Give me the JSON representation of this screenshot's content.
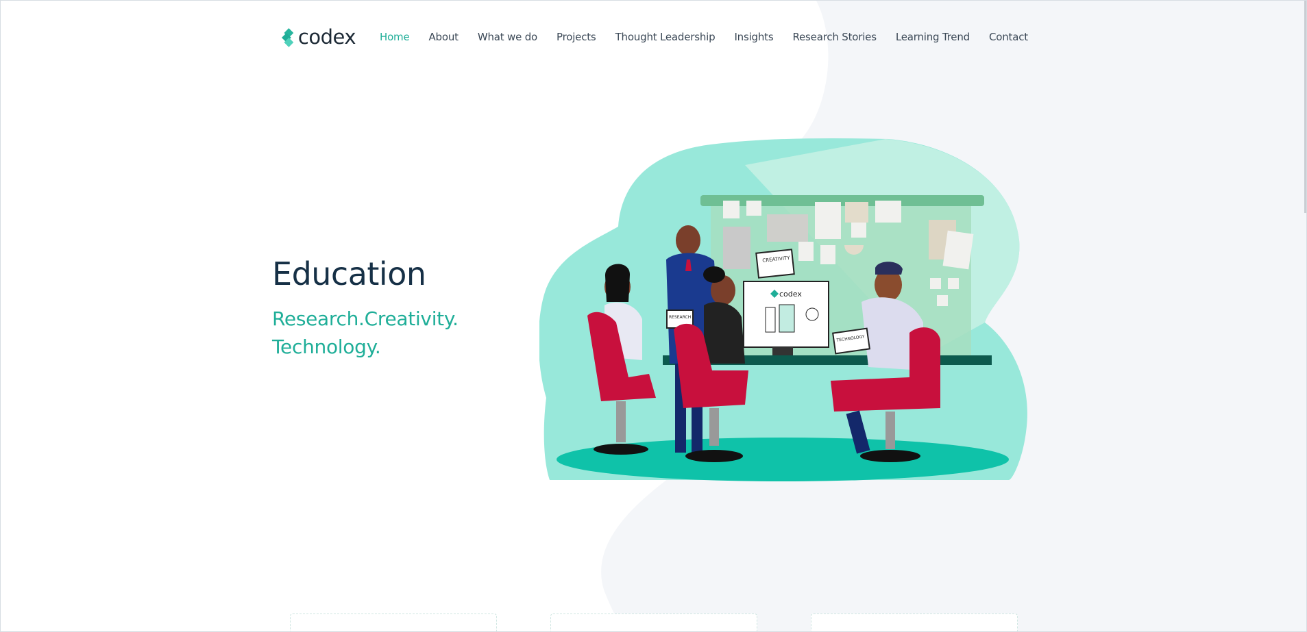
{
  "brand": {
    "logo_text": "codex",
    "accent": "#1fae98",
    "accent_dark": "#0fbfa4"
  },
  "nav": {
    "items": [
      {
        "label": "Home",
        "active": true
      },
      {
        "label": "About",
        "active": false
      },
      {
        "label": "What we do",
        "active": false
      },
      {
        "label": "Projects",
        "active": false
      },
      {
        "label": "Thought Leadership",
        "active": false
      },
      {
        "label": "Insights",
        "active": false
      },
      {
        "label": "Research Stories",
        "active": false
      },
      {
        "label": "Learning Trend",
        "active": false
      },
      {
        "label": "Contact",
        "active": false
      }
    ]
  },
  "hero": {
    "title": "Education",
    "subtitle_line1": "Research.Creativity.",
    "subtitle_line2": "Technology."
  },
  "illustration": {
    "board_label": "CREATIVITY",
    "screen_logo": "codex",
    "tablet_left_label": "RESEARCH",
    "tablet_right_label": "TECHNOLOGY",
    "colors": {
      "blob": "#98e8da",
      "floor": "#0fc2a9",
      "chair": "#c8103d",
      "suit": "#1a3a8f"
    }
  },
  "cards": [
    {
      "label": ""
    },
    {
      "label": ""
    },
    {
      "label": ""
    }
  ]
}
